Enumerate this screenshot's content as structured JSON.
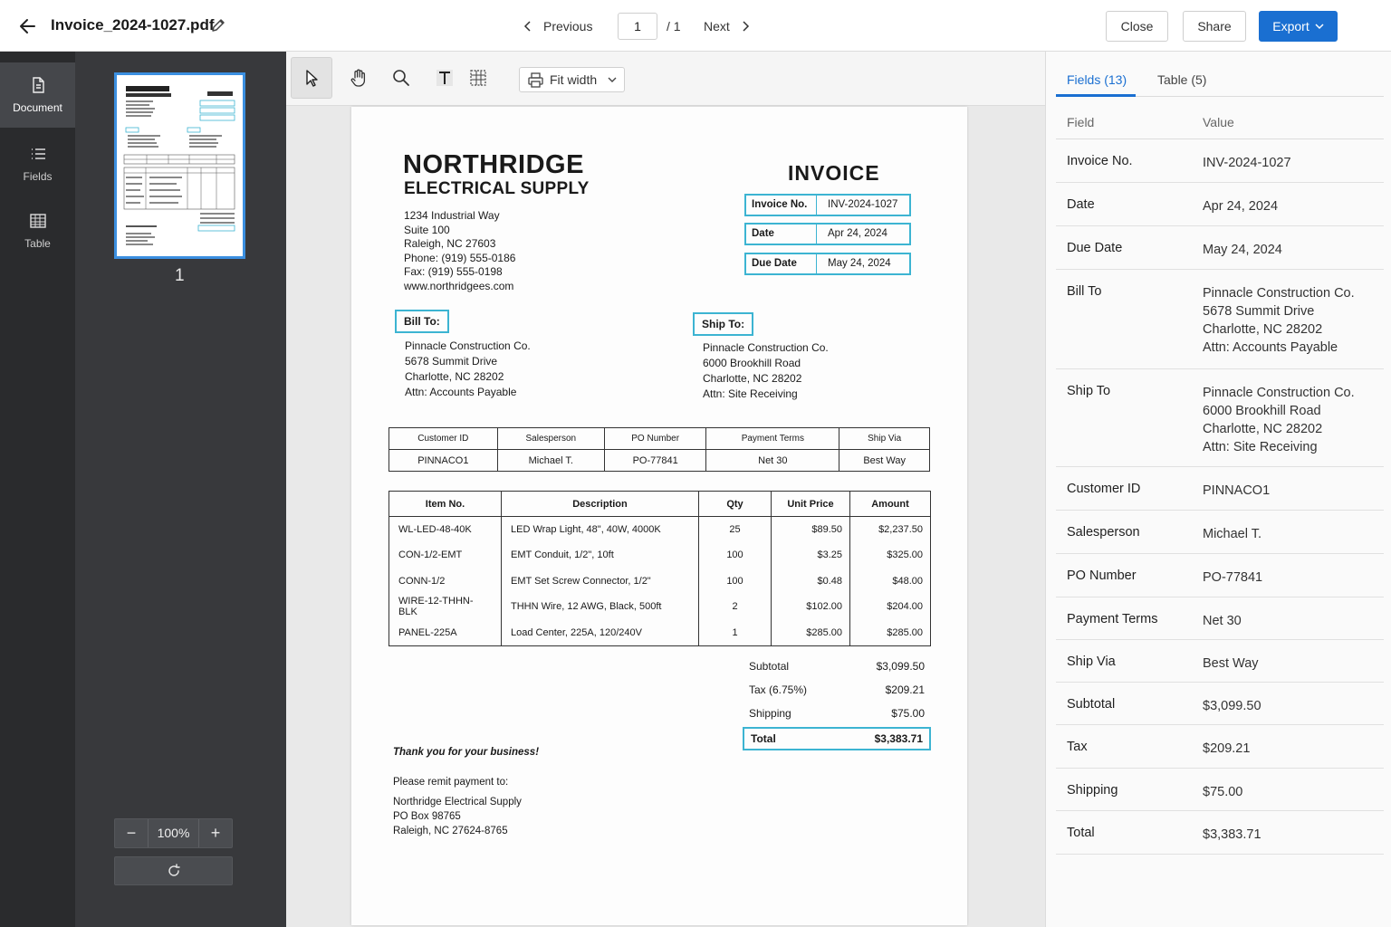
{
  "header": {
    "filename": "Invoice_2024-1027.pdf",
    "prev_label": "Previous",
    "next_label": "Next",
    "page_value": "1",
    "page_total": "/ 1",
    "close_label": "Close",
    "share_label": "Share",
    "export_label": "Export"
  },
  "rail": {
    "items": [
      {
        "label": "Document",
        "icon": "document-icon"
      },
      {
        "label": "Fields",
        "icon": "list-icon"
      },
      {
        "label": "Table",
        "icon": "table-icon"
      }
    ]
  },
  "thumbnails": {
    "page_number": "1",
    "zoom": "100%"
  },
  "toolbar": {
    "fit_label": "Fit width"
  },
  "document": {
    "company_name": "NORTHRIDGE",
    "company_sub": "ELECTRICAL SUPPLY",
    "address_lines": [
      "1234 Industrial Way",
      "Suite 100",
      "Raleigh, NC 27603",
      "Phone: (919) 555-0186",
      "Fax: (919) 555-0198",
      "www.northridgees.com"
    ],
    "title": "INVOICE",
    "meta": [
      {
        "key": "Invoice No.",
        "value": "INV-2024-1027"
      },
      {
        "key": "Date",
        "value": "Apr 24, 2024"
      },
      {
        "key": "Due Date",
        "value": "May 24, 2024"
      }
    ],
    "bill_to_label": "Bill To:",
    "bill_to_lines": [
      "Pinnacle Construction Co.",
      "5678 Summit Drive",
      "Charlotte, NC 28202",
      "Attn: Accounts Payable"
    ],
    "ship_to_label": "Ship To:",
    "ship_to_lines": [
      "Pinnacle Construction Co.",
      "6000 Brookhill Road",
      "Charlotte, NC 28202",
      "Attn: Site Receiving"
    ],
    "info_headers": [
      "Customer ID",
      "Salesperson",
      "PO Number",
      "Payment Terms",
      "Ship Via"
    ],
    "info_values": [
      "PINNACO1",
      "Michael T.",
      "PO-77841",
      "Net 30",
      "Best Way"
    ],
    "item_headers": [
      "Item No.",
      "Description",
      "Qty",
      "Unit Price",
      "Amount"
    ],
    "items": [
      [
        "WL-LED-48-40K",
        "LED Wrap Light, 48\", 40W, 4000K",
        "25",
        "$89.50",
        "$2,237.50"
      ],
      [
        "CON-1/2-EMT",
        "EMT Conduit, 1/2\", 10ft",
        "100",
        "$3.25",
        "$325.00"
      ],
      [
        "CONN-1/2",
        "EMT Set Screw Connector, 1/2\"",
        "100",
        "$0.48",
        "$48.00"
      ],
      [
        "WIRE-12-THHN-BLK",
        "THHN Wire, 12 AWG, Black, 500ft",
        "2",
        "$102.00",
        "$204.00"
      ],
      [
        "PANEL-225A",
        "Load Center, 225A, 120/240V",
        "1",
        "$285.00",
        "$285.00"
      ]
    ],
    "totals": [
      {
        "label": "Subtotal",
        "value": "$3,099.50"
      },
      {
        "label": "Tax (6.75%)",
        "value": "$209.21"
      },
      {
        "label": "Shipping",
        "value": "$75.00"
      }
    ],
    "total_label": "Total",
    "total_value": "$3,383.71",
    "thanks": "Thank you for your business!",
    "remit_lines": [
      "Please remit payment to:",
      "",
      "Northridge Electrical Supply",
      "PO Box 98765",
      "Raleigh, NC 27624-8765"
    ]
  },
  "panel": {
    "tabs": [
      {
        "label": "Fields (13)"
      },
      {
        "label": "Table (5)"
      }
    ],
    "col_field": "Field",
    "col_value": "Value",
    "fields": [
      {
        "key": "Invoice No.",
        "value": "INV-2024-1027"
      },
      {
        "key": "Date",
        "value": "Apr 24, 2024"
      },
      {
        "key": "Due Date",
        "value": "May 24, 2024"
      },
      {
        "key": "Bill To",
        "value": "Pinnacle Construction Co.\n5678 Summit Drive\nCharlotte, NC 28202\nAttn: Accounts Payable"
      },
      {
        "key": "Ship To",
        "value": "Pinnacle Construction Co.\n6000 Brookhill Road\nCharlotte, NC 28202\nAttn: Site Receiving"
      },
      {
        "key": "Customer ID",
        "value": "PINNACO1"
      },
      {
        "key": "Salesperson",
        "value": "Michael T."
      },
      {
        "key": "PO Number",
        "value": "PO-77841"
      },
      {
        "key": "Payment Terms",
        "value": "Net 30"
      },
      {
        "key": "Ship Via",
        "value": "Best Way"
      },
      {
        "key": "Subtotal",
        "value": "$3,099.50"
      },
      {
        "key": "Tax",
        "value": "$209.21"
      },
      {
        "key": "Shipping",
        "value": "$75.00"
      },
      {
        "key": "Total",
        "value": "$3,383.71"
      }
    ]
  },
  "colors": {
    "accent": "#1a6fd1",
    "highlight": "#3cb4d2",
    "rail_bg": "#2a2b2d",
    "thumb_bg": "#38393c"
  }
}
